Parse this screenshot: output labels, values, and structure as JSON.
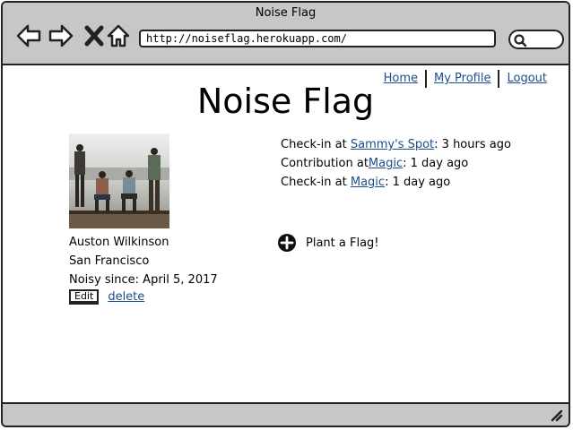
{
  "window": {
    "title": "Noise Flag",
    "url": "http://noiseflag.herokuapp.com/"
  },
  "icons": {
    "back": "arrow-left-icon",
    "forward": "arrow-right-icon",
    "stop": "close-icon",
    "home": "home-icon",
    "search": "search-icon",
    "resize": "resize-grip-icon",
    "add": "plus-circle-icon"
  },
  "nav": {
    "home": "Home",
    "profile": "My Profile",
    "logout": "Logout"
  },
  "page": {
    "title": "Noise Flag"
  },
  "profile": {
    "name": "Auston Wilkinson",
    "location": "San Francisco",
    "since": "Noisy since: April 5, 2017",
    "edit": "Edit",
    "delete": "delete"
  },
  "activity": [
    {
      "prefix": "Check-in at ",
      "place": "Sammy's Spot",
      "suffix": ": 3 hours ago"
    },
    {
      "prefix": "Contribution at",
      "place": "Magic",
      "suffix": ": 1 day ago"
    },
    {
      "prefix": "Check-in at ",
      "place": "Magic",
      "suffix": ": 1 day ago"
    }
  ],
  "plant": {
    "label": "Plant a Flag!"
  }
}
